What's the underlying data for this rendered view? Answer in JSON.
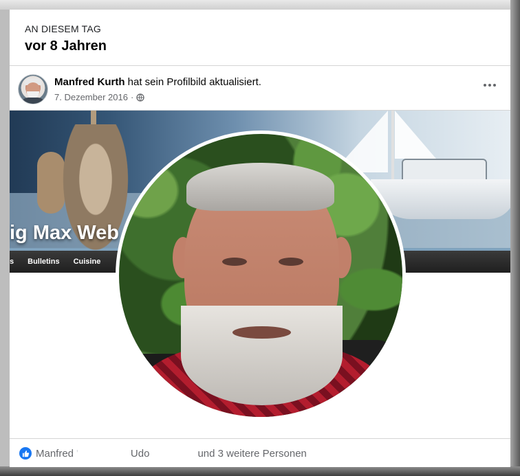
{
  "memory": {
    "label": "AN DIESEM TAG",
    "title": "vor 8 Jahren"
  },
  "post": {
    "author": "Manfred Kurth",
    "action": " hat sein Profilbild aktualisiert.",
    "date": "7. Dezember 2016",
    "separator": "·",
    "audience_icon": "globe-icon",
    "more_icon": "more-options-icon"
  },
  "cover": {
    "title": "ig Max Web",
    "nav": [
      "s",
      "Bulletins",
      "Cuisine"
    ]
  },
  "reactions": {
    "icon": "like-icon",
    "name1": "Manfred",
    "separator": "'",
    "name2": "Udo",
    "rest": "und 3 weitere Personen"
  },
  "colors": {
    "accent": "#1877f2",
    "text": "#050505",
    "muted": "#65676b"
  }
}
